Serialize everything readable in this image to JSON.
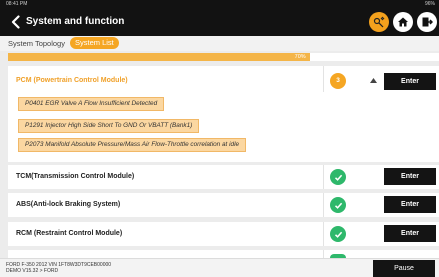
{
  "status_bar": {
    "time": "08:41 PM",
    "battery": "96%"
  },
  "header": {
    "title": "System and function"
  },
  "tabs": [
    {
      "label": "System Topology"
    },
    {
      "label": "System List"
    }
  ],
  "progress": {
    "value": 0.7,
    "label": "70%"
  },
  "modules": [
    {
      "name": "PCM (Powertrain Control Module)",
      "dtc_count": "3",
      "expanded": true,
      "enter_label": "Enter",
      "dtcs": [
        "P0401 EGR Valve A Flow Insufficient Detected",
        "P1291 Injector High Side Short To GND Or VBATT (Bank1)",
        "P2073 Manifold Absolute Pressure/Mass Air Flow-Throttle correlation at idle"
      ]
    },
    {
      "name": "TCM(Transmission Control Module)",
      "status": "ok",
      "enter_label": "Enter"
    },
    {
      "name": "ABS(Anti-lock Braking System)",
      "status": "ok",
      "enter_label": "Enter"
    },
    {
      "name": "RCM (Restraint Control Module)",
      "status": "ok",
      "enter_label": "Enter"
    }
  ],
  "footer": {
    "vehicle_line": "FORD  F-350  2012  VIN  1FT8W3DT9CEB00000",
    "version_line": "DEMO V15.32 > FORD",
    "pause_label": "Pause"
  },
  "colors": {
    "accent": "#f5a623",
    "ok": "#2eb86b",
    "dark": "#141414"
  }
}
